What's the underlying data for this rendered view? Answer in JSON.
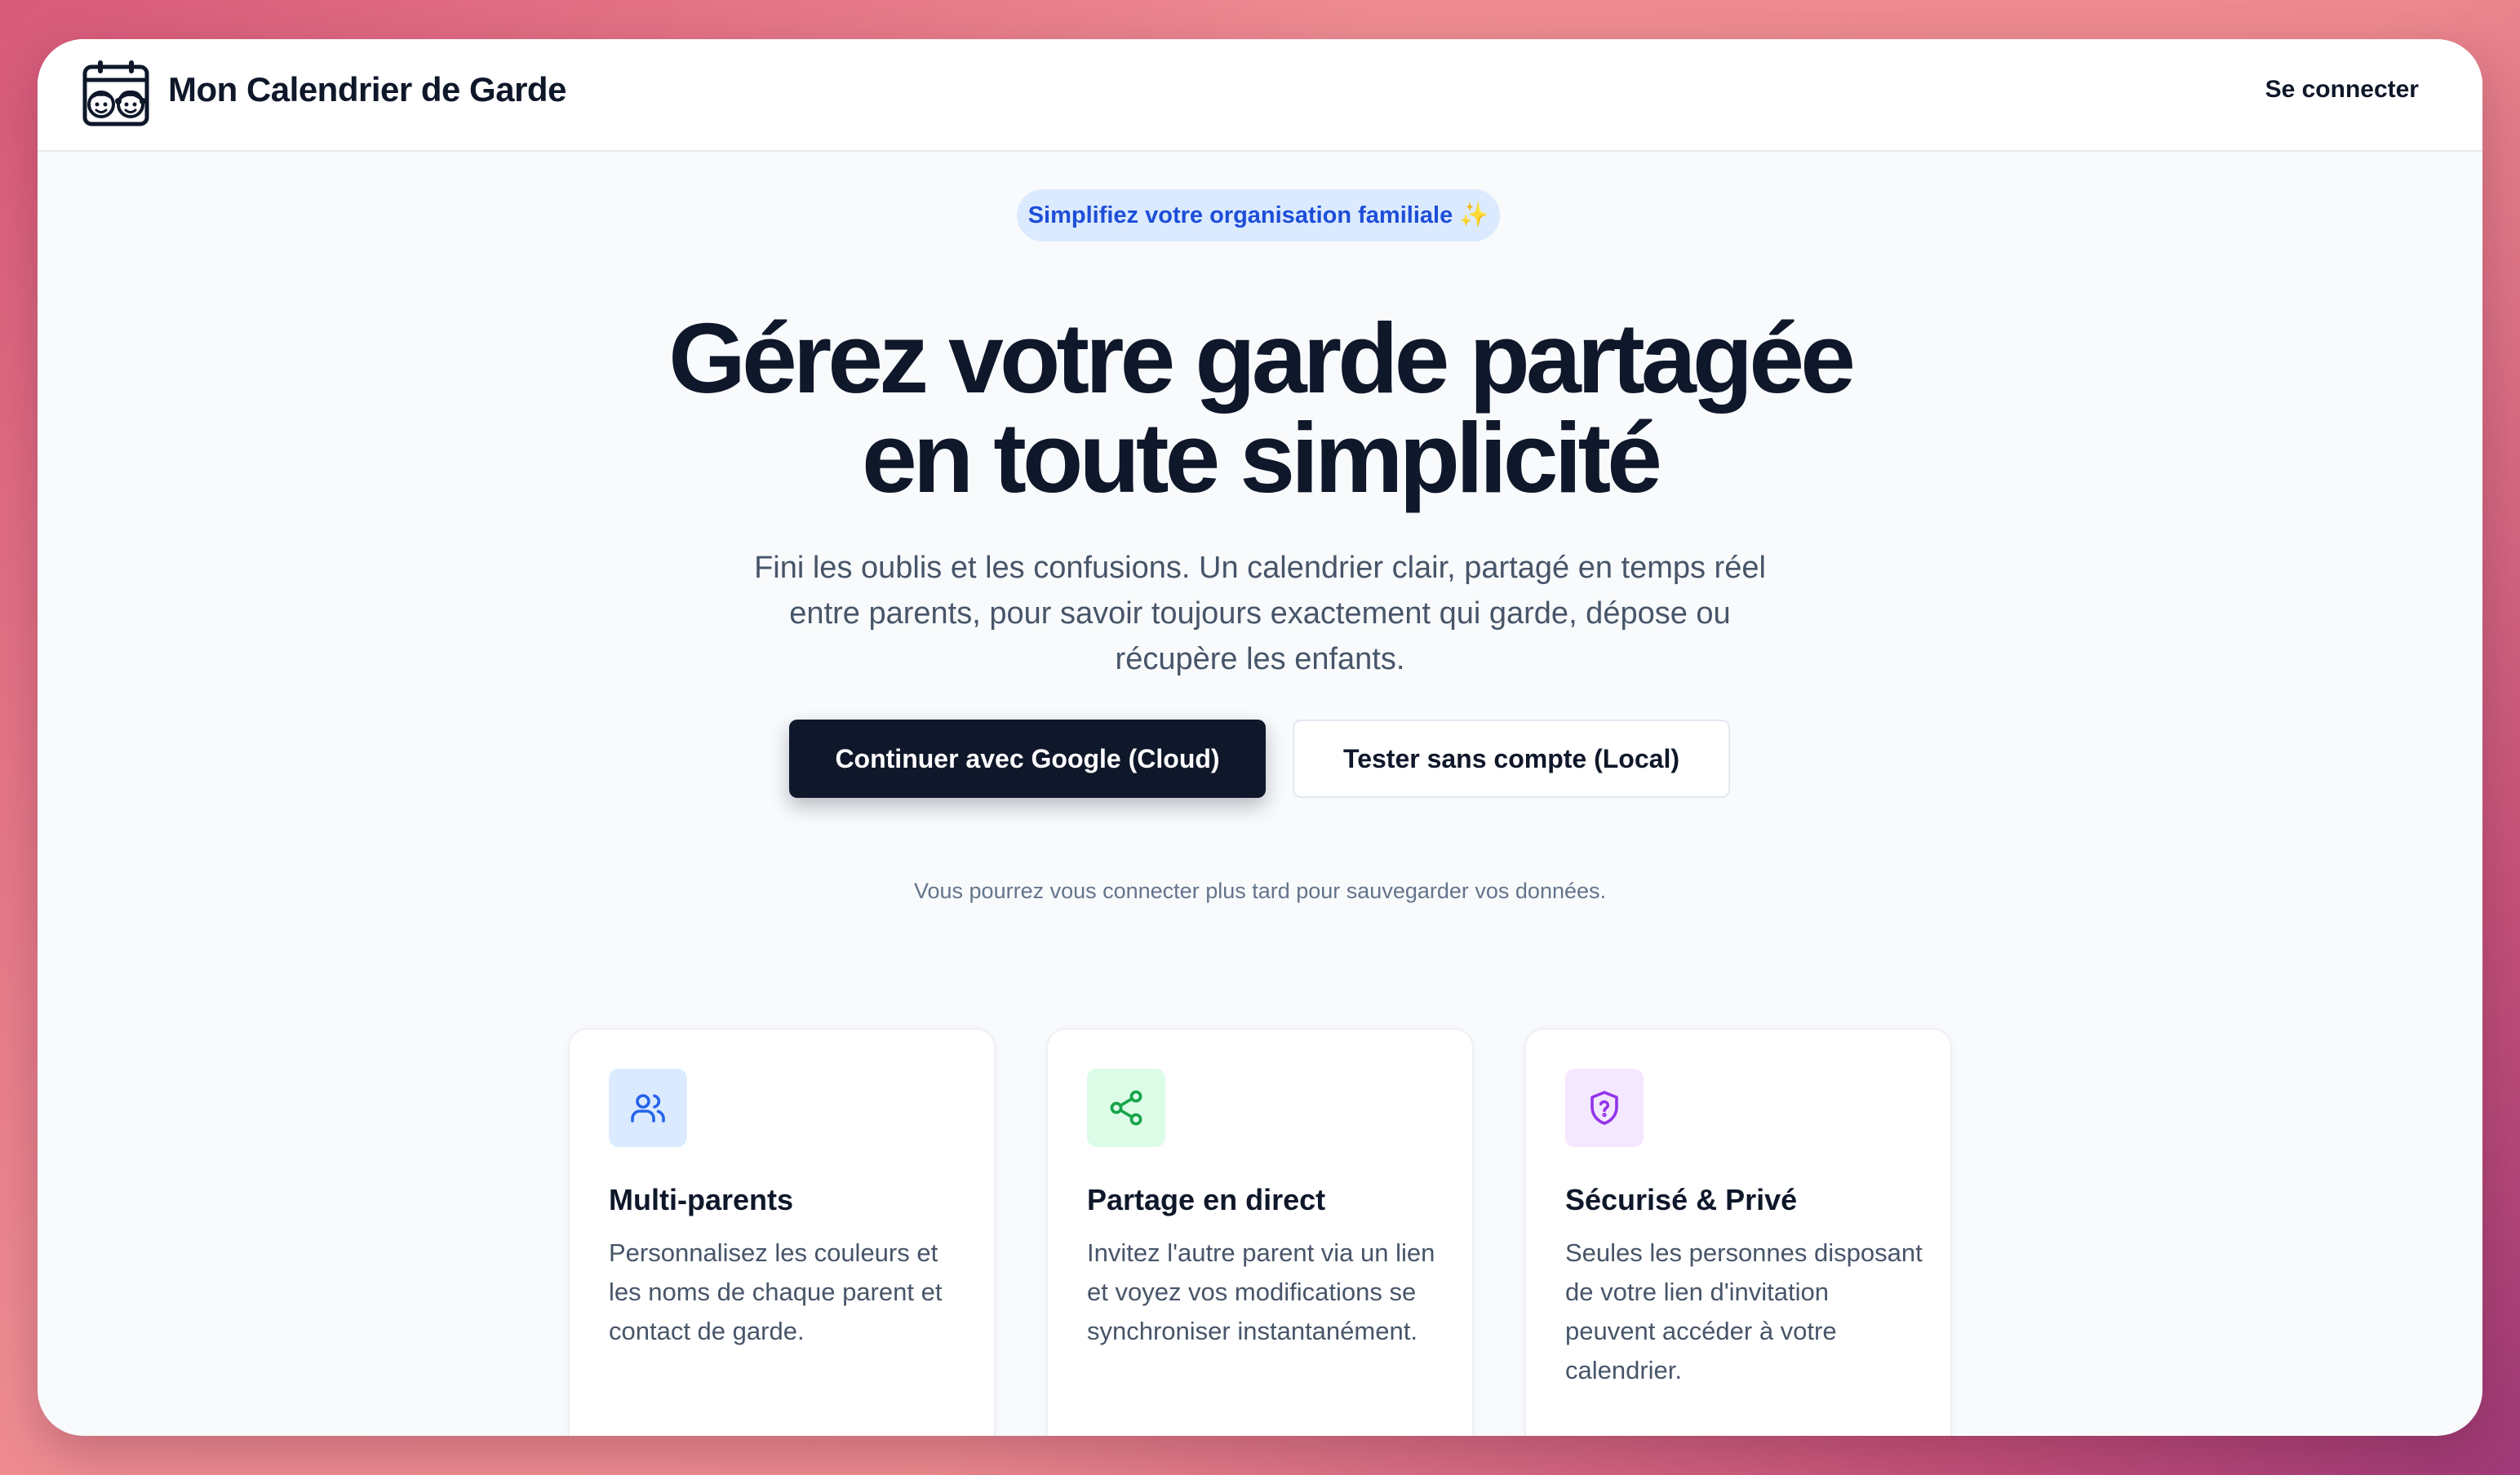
{
  "header": {
    "logo_icon": "kids-calendar-icon",
    "title": "Mon Calendrier de Garde",
    "signin_label": "Se connecter"
  },
  "hero": {
    "badge": "Simplifiez votre organisation familiale",
    "badge_emoji": "✨",
    "title_line1": "Gérez votre garde partagée",
    "title_line2": "en toute simplicité",
    "subtitle": "Fini les oublis et les confusions. Un calendrier clair, partagé en temps réel entre parents, pour savoir toujours exactement qui garde, dépose ou récupère les enfants.",
    "primary_button": "Continuer avec Google (Cloud)",
    "secondary_button": "Tester sans compte (Local)",
    "note": "Vous pourrez vous connecter plus tard pour sauvegarder vos données."
  },
  "features": [
    {
      "icon": "users-icon",
      "title": "Multi-parents",
      "text": "Personnalisez les couleurs et les noms de chaque parent et contact de garde."
    },
    {
      "icon": "share-icon",
      "title": "Partage en direct",
      "text": "Invitez l'autre parent via un lien et voyez vos modifications se synchroniser instantanément."
    },
    {
      "icon": "shield-question-icon",
      "title": "Sécurisé & Privé",
      "text": "Seules les personnes disposant de votre lien d'invitation peuvent accéder à votre calendrier."
    }
  ],
  "colors": {
    "primary": "#0f172a",
    "badge_bg": "#dbeafe",
    "badge_text": "#1d4ed8",
    "users_icon": "#2563eb",
    "share_icon": "#16a34a",
    "shield_icon": "#9333ea"
  }
}
